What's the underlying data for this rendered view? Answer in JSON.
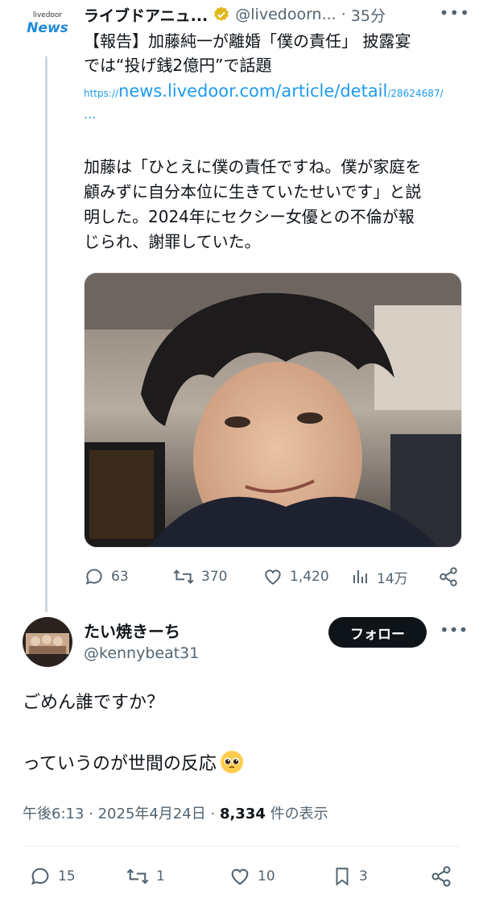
{
  "quoted_tweet": {
    "logo_small": "livedoor",
    "logo_big": "News",
    "author_name": "ライブドアニュ...",
    "author_handle": "@livedoorn...",
    "separator": "·",
    "time": "35分",
    "title_line1": "【報告】加藤純一が離婚「僕の責任」 披露宴",
    "title_line2": "では“投げ銭2億円”で話題",
    "link_prefix": "https://",
    "link_main": "news.livedoor.com/article/detail",
    "link_suffix": "/28624687/",
    "link_more": "...",
    "body_line1": "加藤は「ひとえに僕の責任ですね。僕が家庭を",
    "body_line2": "顧みずに自分本位に生きていたせいです」と説",
    "body_line3": "明した。2024年にセクシー女優との不倫が報",
    "body_line4": "じられ、謝罪していた。",
    "stats": {
      "replies": "63",
      "retweets": "370",
      "likes": "1,420",
      "views": "14万"
    }
  },
  "reply_tweet": {
    "author_name": "たい焼きーち",
    "author_handle": "@kennybeat31",
    "follow_label": "フォロー",
    "body_line1": "ごめん誰ですか？",
    "body_line2": "っていうのが世間の反応",
    "meta_time": "午後6:13",
    "meta_sep1": " · ",
    "meta_date": "2025年4月24日",
    "meta_sep2": " · ",
    "meta_views": "8,334",
    "meta_views_label": " 件の表示",
    "stats": {
      "replies": "15",
      "retweets": "1",
      "likes": "10",
      "bookmarks": "3"
    }
  },
  "colors": {
    "accent": "#1d9bf0",
    "muted": "#536471",
    "text": "#0f1419",
    "verified": "#e2b719"
  }
}
